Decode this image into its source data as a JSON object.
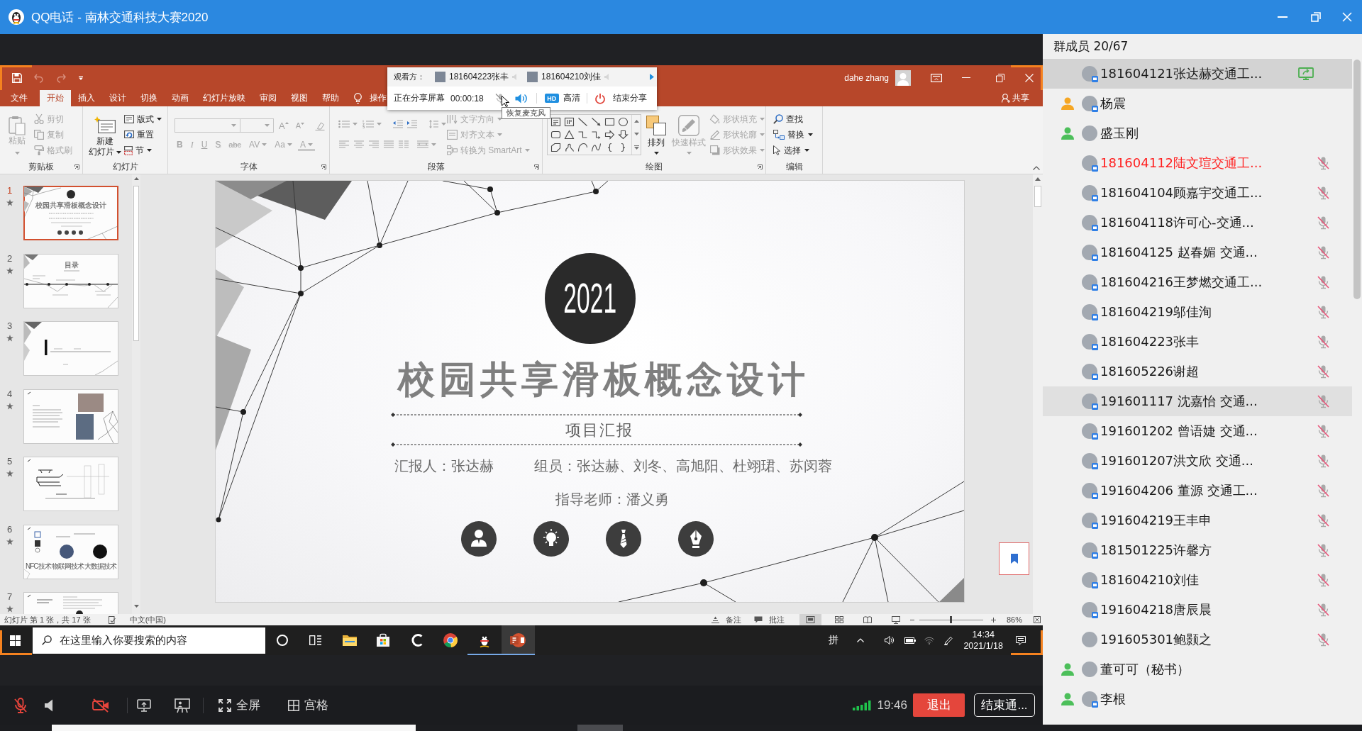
{
  "window": {
    "title": "QQ电话 - 南林交通科技大赛2020"
  },
  "share_panel": {
    "viewers_label": "观看方：",
    "viewers": [
      {
        "name": "181604223张丰"
      },
      {
        "name": "181604210刘佳"
      }
    ],
    "status": "正在分享屏幕",
    "elapsed": "00:00:18",
    "mic_muted": true,
    "hd_badge": "HD",
    "quality": "高清",
    "stop": "结束分享",
    "tooltip": "恢复麦克风"
  },
  "powerpoint": {
    "user": "dahe zhang",
    "tabs": [
      {
        "label": "文件",
        "selected": false
      },
      {
        "label": "开始",
        "selected": true
      },
      {
        "label": "插入",
        "selected": false
      },
      {
        "label": "设计",
        "selected": false
      },
      {
        "label": "切换",
        "selected": false
      },
      {
        "label": "动画",
        "selected": false
      },
      {
        "label": "幻灯片放映",
        "selected": false
      },
      {
        "label": "审阅",
        "selected": false
      },
      {
        "label": "视图",
        "selected": false
      },
      {
        "label": "帮助",
        "selected": false
      }
    ],
    "tell_me": "操作",
    "share": "共享",
    "ribbon": {
      "clipboard": {
        "label": "剪贴板",
        "paste": {
          "label": "粘贴",
          "disabled": true
        },
        "commands": [
          {
            "kind": "cut",
            "label": "剪切",
            "disabled": true
          },
          {
            "kind": "copy",
            "label": "复制",
            "disabled": true
          },
          {
            "kind": "format-painter",
            "label": "格式刷",
            "disabled": true
          }
        ]
      },
      "slides": {
        "label": "幻灯片",
        "new_slide": [
          "新建",
          "幻灯片"
        ],
        "commands": [
          {
            "kind": "layout",
            "label": "版式",
            "dropdown": true
          },
          {
            "kind": "reset",
            "label": "重置",
            "dropdown": false
          },
          {
            "kind": "section",
            "label": "节",
            "dropdown": true
          }
        ]
      },
      "font": {
        "label": "字体",
        "disabled": true,
        "size_buttons": [
          "A",
          "A"
        ],
        "format_buttons": [
          {
            "kind": "bold",
            "label": "B"
          },
          {
            "kind": "italic",
            "label": "I"
          },
          {
            "kind": "underline",
            "label": "U"
          },
          {
            "kind": "shadow",
            "label": "S"
          },
          {
            "kind": "strikethrough",
            "label": "abc"
          },
          {
            "kind": "spacing",
            "label": "AV"
          },
          {
            "kind": "case",
            "label": "Aa"
          },
          {
            "kind": "color",
            "label": "A"
          }
        ]
      },
      "paragraph": {
        "label": "段落",
        "disabled": true,
        "commands": [
          {
            "kind": "text-direction",
            "label": "文字方向"
          },
          {
            "kind": "align-text",
            "label": "对齐文本"
          },
          {
            "kind": "smartart",
            "label": "转换为 SmartArt"
          }
        ]
      },
      "drawing": {
        "label": "绘图",
        "arrange": {
          "label": "排列",
          "disabled": false
        },
        "quick_styles": {
          "label": "快速样式",
          "disabled": true
        },
        "commands": [
          {
            "kind": "fill",
            "label": "形状填充",
            "disabled": true
          },
          {
            "kind": "outline",
            "label": "形状轮廓",
            "disabled": true
          },
          {
            "kind": "effects",
            "label": "形状效果",
            "disabled": true
          }
        ]
      },
      "editing": {
        "label": "编辑",
        "commands": [
          {
            "kind": "find",
            "label": "查找",
            "dropdown": false
          },
          {
            "kind": "replace",
            "label": "替换",
            "dropdown": true
          },
          {
            "kind": "select",
            "label": "选择",
            "dropdown": true
          }
        ]
      }
    },
    "thumbnails": [
      {
        "number": "1",
        "kind": "title",
        "selected": true,
        "texts": [
          "校园共享滑板概念设计"
        ]
      },
      {
        "number": "2",
        "kind": "contents",
        "selected": false,
        "texts": [
          "目录"
        ]
      },
      {
        "number": "3",
        "kind": "section",
        "selected": false
      },
      {
        "number": "4",
        "kind": "photos",
        "selected": false
      },
      {
        "number": "5",
        "kind": "sketch",
        "selected": false
      },
      {
        "number": "6",
        "kind": "tech",
        "selected": false,
        "texts": [
          "NFC技术",
          "物联网技术",
          "大数据技术"
        ]
      },
      {
        "number": "7",
        "kind": "text",
        "selected": false
      }
    ],
    "slide": {
      "year": "2021",
      "title": "校园共享滑板概念设计",
      "subtitle": "项目汇报",
      "reporter": "汇报人：张达赫",
      "members": "组员：张达赫、刘冬、高旭阳、杜翊珺、苏闵蓉",
      "advisor": "指导老师：潘义勇"
    },
    "status_bar": {
      "slide_info": "幻灯片 第 1 张，共 17 张",
      "language": "中文(中国)",
      "notes": "备注",
      "comments": "批注",
      "views": [
        {
          "kind": "normal",
          "selected": true
        },
        {
          "kind": "sorter",
          "selected": false
        },
        {
          "kind": "reading",
          "selected": false
        },
        {
          "kind": "slideshow",
          "selected": false
        }
      ],
      "zoom": {
        "level": 0.5,
        "reading": "86%"
      }
    }
  },
  "taskbar": {
    "search_placeholder": "在这里输入你要搜索的内容",
    "apps": [
      {
        "kind": "cortana",
        "running": false,
        "selected": false
      },
      {
        "kind": "task-view",
        "running": false,
        "selected": false
      },
      {
        "kind": "file-explorer",
        "running": false,
        "selected": false
      },
      {
        "kind": "store",
        "running": false,
        "selected": false
      },
      {
        "kind": "ccleaner",
        "running": false,
        "selected": false
      },
      {
        "kind": "chrome",
        "running": false,
        "selected": false
      },
      {
        "kind": "qq",
        "running": true,
        "selected": false
      },
      {
        "kind": "powerpoint",
        "running": true,
        "selected": true
      }
    ],
    "ime": "拼",
    "time": "14:34",
    "date": "2021/1/18"
  },
  "call_toolbar": {
    "mic_muted": true,
    "camera_off": true,
    "fullscreen": "全屏",
    "grid": "宫格",
    "duration": "19:46",
    "leave": "退出",
    "end": "结束通..."
  },
  "members": {
    "title": "群成员 20/67",
    "items": [
      {
        "name": "181604121张达赫交通工...",
        "selected": true,
        "hovered": false,
        "highlighted": false,
        "badge": true,
        "sharing": true,
        "muted": false
      },
      {
        "name": "杨震",
        "role": {
          "color": "#f5a623"
        },
        "selected": false,
        "hovered": false,
        "highlighted": false,
        "badge": true,
        "sharing": false,
        "muted": false
      },
      {
        "name": "盛玉刚",
        "role": {
          "color": "#4cbf5a"
        },
        "selected": false,
        "hovered": false,
        "highlighted": false,
        "badge": false,
        "sharing": false,
        "muted": false
      },
      {
        "name": "181604112陆文瑄交通工...",
        "selected": false,
        "hovered": false,
        "highlighted": true,
        "badge": true,
        "sharing": false,
        "muted": true
      },
      {
        "name": "181604104顾嘉宇交通工...",
        "selected": false,
        "hovered": false,
        "highlighted": false,
        "badge": true,
        "sharing": false,
        "muted": true
      },
      {
        "name": "181604118许可心-交通...",
        "selected": false,
        "hovered": false,
        "highlighted": false,
        "badge": true,
        "sharing": false,
        "muted": true
      },
      {
        "name": "181604125 赵春媚 交通...",
        "selected": false,
        "hovered": false,
        "highlighted": false,
        "badge": true,
        "sharing": false,
        "muted": true
      },
      {
        "name": "181604216王梦燃交通工...",
        "selected": false,
        "hovered": false,
        "highlighted": false,
        "badge": true,
        "sharing": false,
        "muted": true
      },
      {
        "name": "181604219邬佳洵",
        "selected": false,
        "hovered": false,
        "highlighted": false,
        "badge": true,
        "sharing": false,
        "muted": true
      },
      {
        "name": "181604223张丰",
        "selected": false,
        "hovered": false,
        "highlighted": false,
        "badge": true,
        "sharing": false,
        "muted": true
      },
      {
        "name": "181605226谢超",
        "selected": false,
        "hovered": false,
        "highlighted": false,
        "badge": true,
        "sharing": false,
        "muted": true
      },
      {
        "name": "191601117 沈嘉怡 交通...",
        "selected": false,
        "hovered": true,
        "highlighted": false,
        "badge": true,
        "sharing": false,
        "muted": true
      },
      {
        "name": "191601202 曾语婕 交通...",
        "selected": false,
        "hovered": false,
        "highlighted": false,
        "badge": true,
        "sharing": false,
        "muted": true
      },
      {
        "name": "191601207洪文欣 交通...",
        "selected": false,
        "hovered": false,
        "highlighted": false,
        "badge": true,
        "sharing": false,
        "muted": true
      },
      {
        "name": "191604206 董源 交通工...",
        "selected": false,
        "hovered": false,
        "highlighted": false,
        "badge": true,
        "sharing": false,
        "muted": true
      },
      {
        "name": "191604219王丰申",
        "selected": false,
        "hovered": false,
        "highlighted": false,
        "badge": true,
        "sharing": false,
        "muted": true
      },
      {
        "name": "181501225许馨方",
        "selected": false,
        "hovered": false,
        "highlighted": false,
        "badge": true,
        "sharing": false,
        "muted": true
      },
      {
        "name": "181604210刘佳",
        "selected": false,
        "hovered": false,
        "highlighted": false,
        "badge": true,
        "sharing": false,
        "muted": true
      },
      {
        "name": "191604218唐辰晨",
        "selected": false,
        "hovered": false,
        "highlighted": false,
        "badge": true,
        "sharing": false,
        "muted": true
      },
      {
        "name": "191605301鲍颢之",
        "selected": false,
        "hovered": false,
        "highlighted": false,
        "badge": false,
        "sharing": false,
        "muted": true
      },
      {
        "name": "董可可（秘书）",
        "role": {
          "color": "#4cbf5a"
        },
        "selected": false,
        "hovered": false,
        "highlighted": false,
        "badge": false,
        "sharing": false,
        "muted": false
      },
      {
        "name": "李根",
        "role": {
          "color": "#4cbf5a"
        },
        "selected": false,
        "hovered": false,
        "highlighted": false,
        "badge": true,
        "sharing": false,
        "muted": false
      }
    ]
  }
}
